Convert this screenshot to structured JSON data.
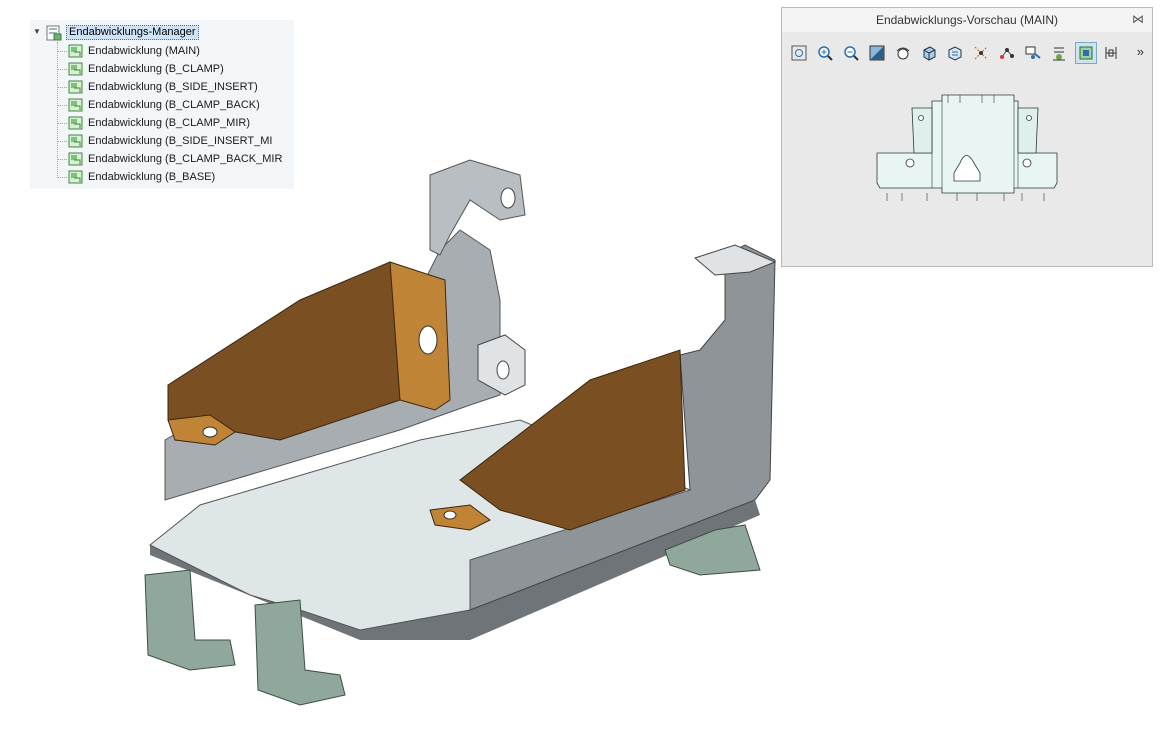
{
  "tree": {
    "root_label": "Endabwicklungs-Manager",
    "items": [
      {
        "label": "Endabwicklung (MAIN)"
      },
      {
        "label": "Endabwicklung (B_CLAMP)"
      },
      {
        "label": "Endabwicklung (B_SIDE_INSERT)"
      },
      {
        "label": "Endabwicklung (B_CLAMP_BACK)"
      },
      {
        "label": "Endabwicklung (B_CLAMP_MIR)"
      },
      {
        "label": "Endabwicklung (B_SIDE_INSERT_MI"
      },
      {
        "label": "Endabwicklung (B_CLAMP_BACK_MIR"
      },
      {
        "label": "Endabwicklung (B_BASE)"
      }
    ]
  },
  "preview": {
    "title": "Endabwicklungs-Vorschau (MAIN)",
    "close_icon": "close-icon",
    "more_icon": "chevron-double-right-icon",
    "toolbar": [
      "zoom-fit-icon",
      "zoom-in-icon",
      "zoom-out-icon",
      "shading-icon",
      "view-orient-icon",
      "cube-view-icon",
      "saved-views-icon",
      "datum-axes-icon",
      "datum-points-icon",
      "datum-planes-icon",
      "spin-center-icon",
      "bend-lines-icon",
      "flat-state-icon",
      "dimension-icon"
    ]
  },
  "colors": {
    "sheet_metal": "#c9cdd0",
    "sheet_dark": "#8c9195",
    "highlight_orange": "#b8792a",
    "orange_dark": "#7a4a18",
    "green_clip": "#8fa89b",
    "selection": "#cfe3f7"
  }
}
